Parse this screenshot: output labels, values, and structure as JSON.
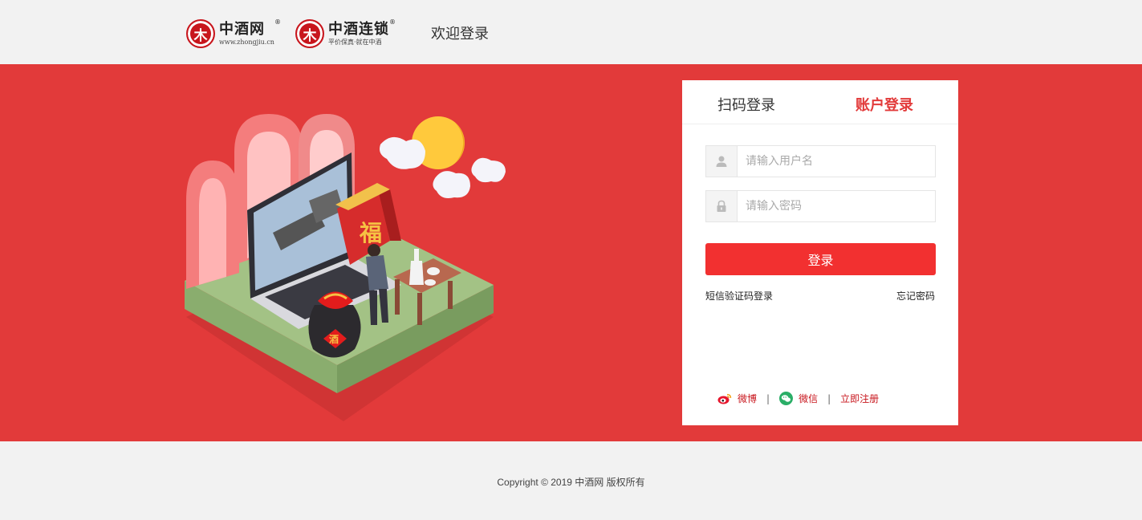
{
  "header": {
    "logo1": {
      "mark": "木",
      "name": "中酒网",
      "reg": "®",
      "sub": "www.zhongjiu.cn"
    },
    "logo2": {
      "mark": "木",
      "name": "中酒连锁",
      "reg": "®",
      "sub": "平价保真·就在中酒"
    },
    "welcome": "欢迎登录"
  },
  "illustration": {
    "label_fu": "福",
    "label_jiu": "酒"
  },
  "login": {
    "tab_qr": "扫码登录",
    "tab_account": "账户登录",
    "username_placeholder": "请输入用户名",
    "password_placeholder": "请输入密码",
    "login_button": "登录",
    "sms_login": "短信验证码登录",
    "forgot_password": "忘记密码",
    "social": {
      "weibo": "微博",
      "wechat": "微信",
      "register": "立即注册",
      "separator": "|"
    }
  },
  "footer": {
    "copyright": "Copyright © 2019   中酒网 版权所有"
  },
  "colors": {
    "brand_red": "#e23a3a",
    "button_red": "#f23030",
    "link_red": "#c8161d"
  }
}
